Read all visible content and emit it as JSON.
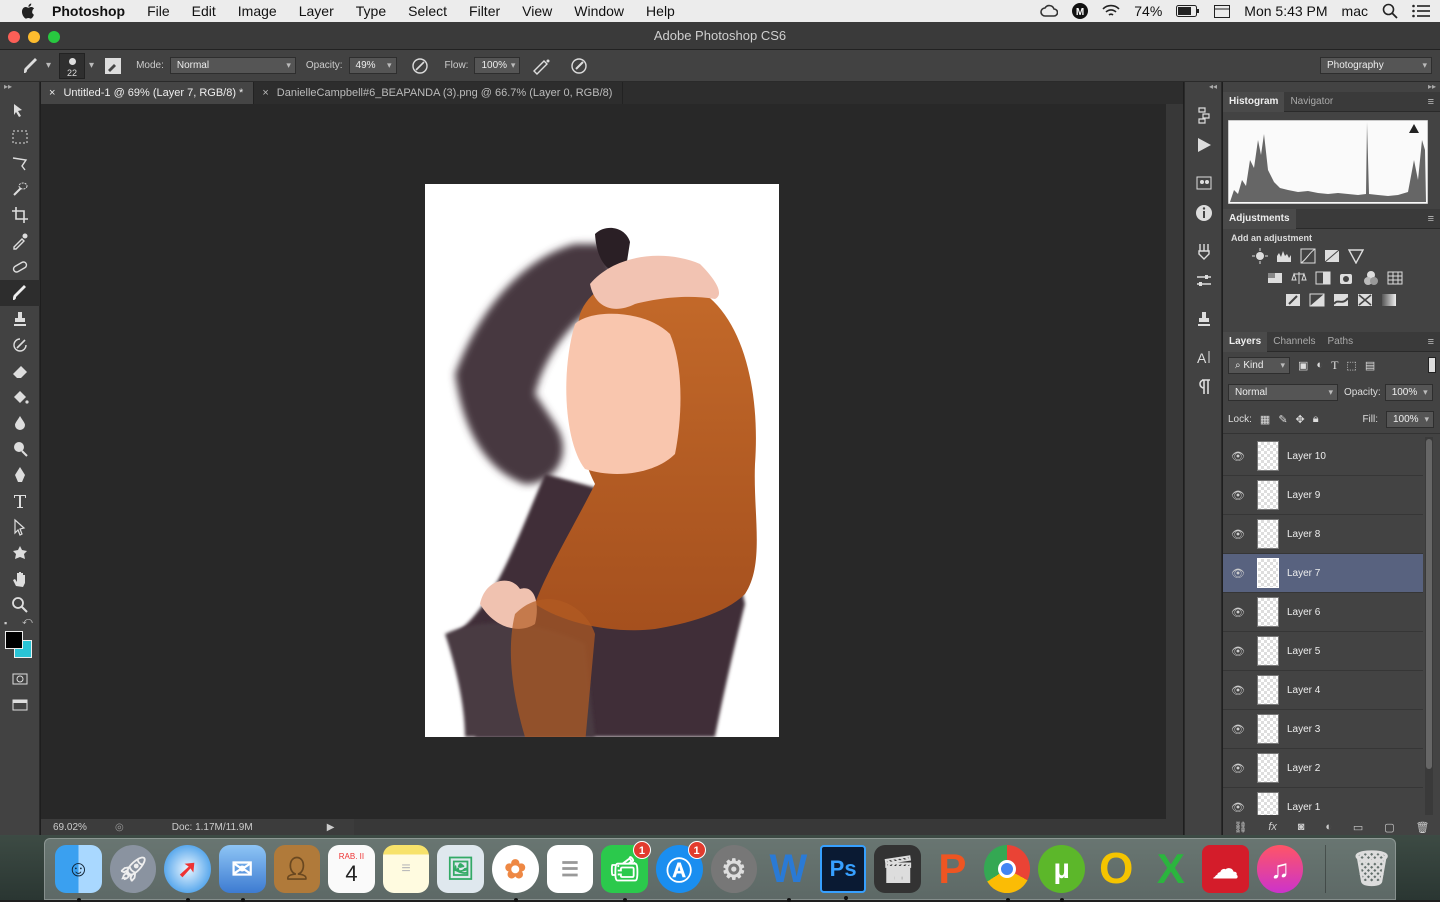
{
  "menubar": {
    "app_name": "Photoshop",
    "items": [
      "File",
      "Edit",
      "Image",
      "Layer",
      "Type",
      "Select",
      "Filter",
      "View",
      "Window",
      "Help"
    ],
    "battery": "74%",
    "clock": "Mon 5:43 PM",
    "user": "mac"
  },
  "window": {
    "title": "Adobe Photoshop CS6"
  },
  "options": {
    "brush_size": "22",
    "mode_label": "Mode:",
    "mode_value": "Normal",
    "opacity_label": "Opacity:",
    "opacity_value": "49%",
    "flow_label": "Flow:",
    "flow_value": "100%",
    "workspace": "Photography"
  },
  "doc_tabs": [
    {
      "label": "Untitled-1 @ 69% (Layer 7, RGB/8) *",
      "active": true
    },
    {
      "label": "DanielleCampbell#6_BEAPANDA (3).png @ 66.7% (Layer 0, RGB/8)",
      "active": false
    }
  ],
  "status": {
    "zoom": "69.02%",
    "doc": "Doc: 1.17M/11.9M"
  },
  "histogram_panel": {
    "tabs": [
      "Histogram",
      "Navigator"
    ]
  },
  "adjustments_panel": {
    "tab": "Adjustments",
    "subtitle": "Add an adjustment"
  },
  "layers_panel": {
    "tabs": [
      "Layers",
      "Channels",
      "Paths"
    ],
    "filter_label": "Kind",
    "blend_mode": "Normal",
    "opacity_label": "Opacity:",
    "opacity_value": "100%",
    "lock_label": "Lock:",
    "fill_label": "Fill:",
    "fill_value": "100%",
    "layers": [
      {
        "name": "Layer 10",
        "selected": false
      },
      {
        "name": "Layer 9",
        "selected": false
      },
      {
        "name": "Layer 8",
        "selected": false
      },
      {
        "name": "Layer 7",
        "selected": true
      },
      {
        "name": "Layer 6",
        "selected": false
      },
      {
        "name": "Layer 5",
        "selected": false
      },
      {
        "name": "Layer 4",
        "selected": false
      },
      {
        "name": "Layer 3",
        "selected": false
      },
      {
        "name": "Layer 2",
        "selected": false
      },
      {
        "name": "Layer 1",
        "selected": false
      }
    ]
  },
  "dock": {
    "calendar_month": "RAB. II",
    "calendar_day": "4",
    "facetime_badge": "1",
    "appstore_badge": "1",
    "word_letter": "W",
    "ps_letters": "Ps"
  },
  "colors": {
    "foreground": "#000000",
    "background": "#29c4d6",
    "selected_layer": "#58627f"
  }
}
